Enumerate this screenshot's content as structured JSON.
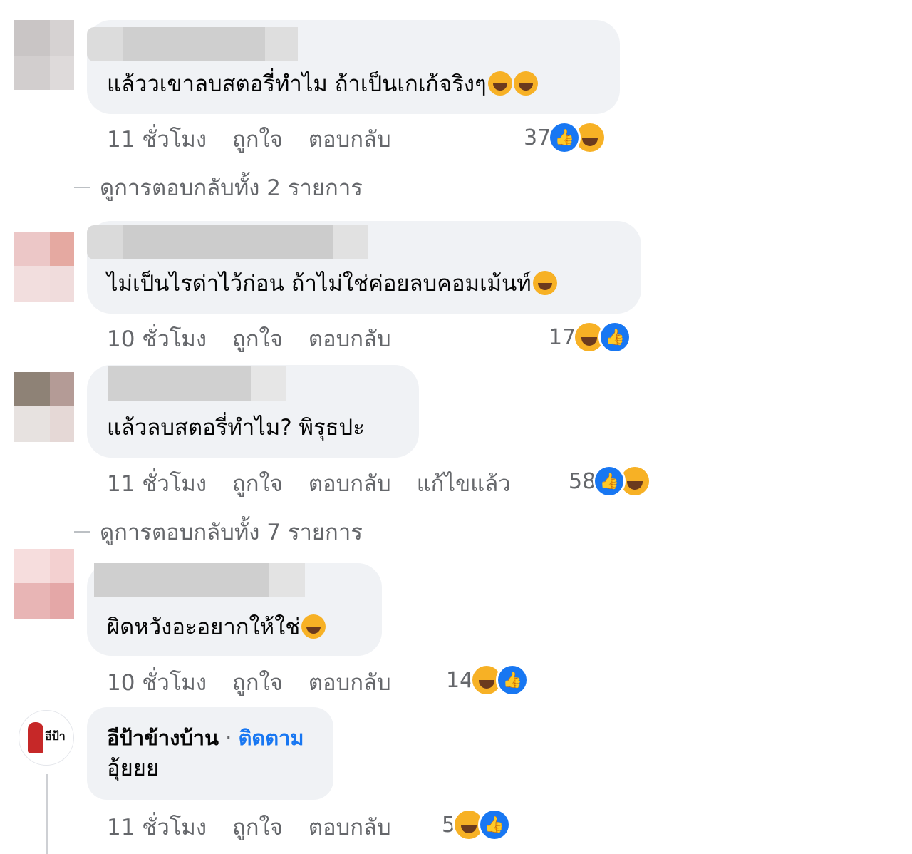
{
  "comments": [
    {
      "text": "แล้ววเขาลบสตอรี่ทำไม ถ้าเป็นเกเก้จริงๆ",
      "emoji": [
        "grinning-squint-face",
        "grinning-squint-face"
      ],
      "time": "11 ชั่วโมง",
      "like": "ถูกใจ",
      "reply": "ตอบกลับ",
      "reactions": {
        "count": "37",
        "icons": [
          "like",
          "haha"
        ]
      },
      "view_replies": "ดูการตอบกลับทั้ง 2 รายการ"
    },
    {
      "text": "ไม่เป็นไรด่าไว้ก่อน ถ้าไม่ใช่ค่อยลบคอมเม้นท์",
      "emoji": [
        "tears-of-joy-face"
      ],
      "time": "10 ชั่วโมง",
      "like": "ถูกใจ",
      "reply": "ตอบกลับ",
      "reactions": {
        "count": "17",
        "icons": [
          "haha",
          "like"
        ]
      }
    },
    {
      "text": "แล้วลบสตอรี่ทำไม? พิรุธปะ",
      "time": "11 ชั่วโมง",
      "like": "ถูกใจ",
      "reply": "ตอบกลับ",
      "edited": "แก้ไขแล้ว",
      "reactions": {
        "count": "58",
        "icons": [
          "like",
          "haha"
        ]
      },
      "view_replies": "ดูการตอบกลับทั้ง 7 รายการ"
    },
    {
      "text": "ผิดหวังอะอยากให้ใช่",
      "emoji": [
        "flushed-face"
      ],
      "time": "10 ชั่วโมง",
      "like": "ถูกใจ",
      "reply": "ตอบกลับ",
      "reactions": {
        "count": "14",
        "icons": [
          "haha",
          "like"
        ]
      }
    },
    {
      "author": "อีป้าข้างบ้าน",
      "follow": "ติดตาม",
      "text": "อุ้ยยย",
      "time": "11 ชั่วโมง",
      "like": "ถูกใจ",
      "reply": "ตอบกลับ",
      "reactions": {
        "count": "5",
        "icons": [
          "haha",
          "like"
        ]
      },
      "avatar_logo_text": "อีป้า"
    }
  ],
  "colors": {
    "bubble": "#f0f2f5",
    "link": "#1877f2",
    "muted": "#65676b",
    "haha": "#f7b125"
  }
}
